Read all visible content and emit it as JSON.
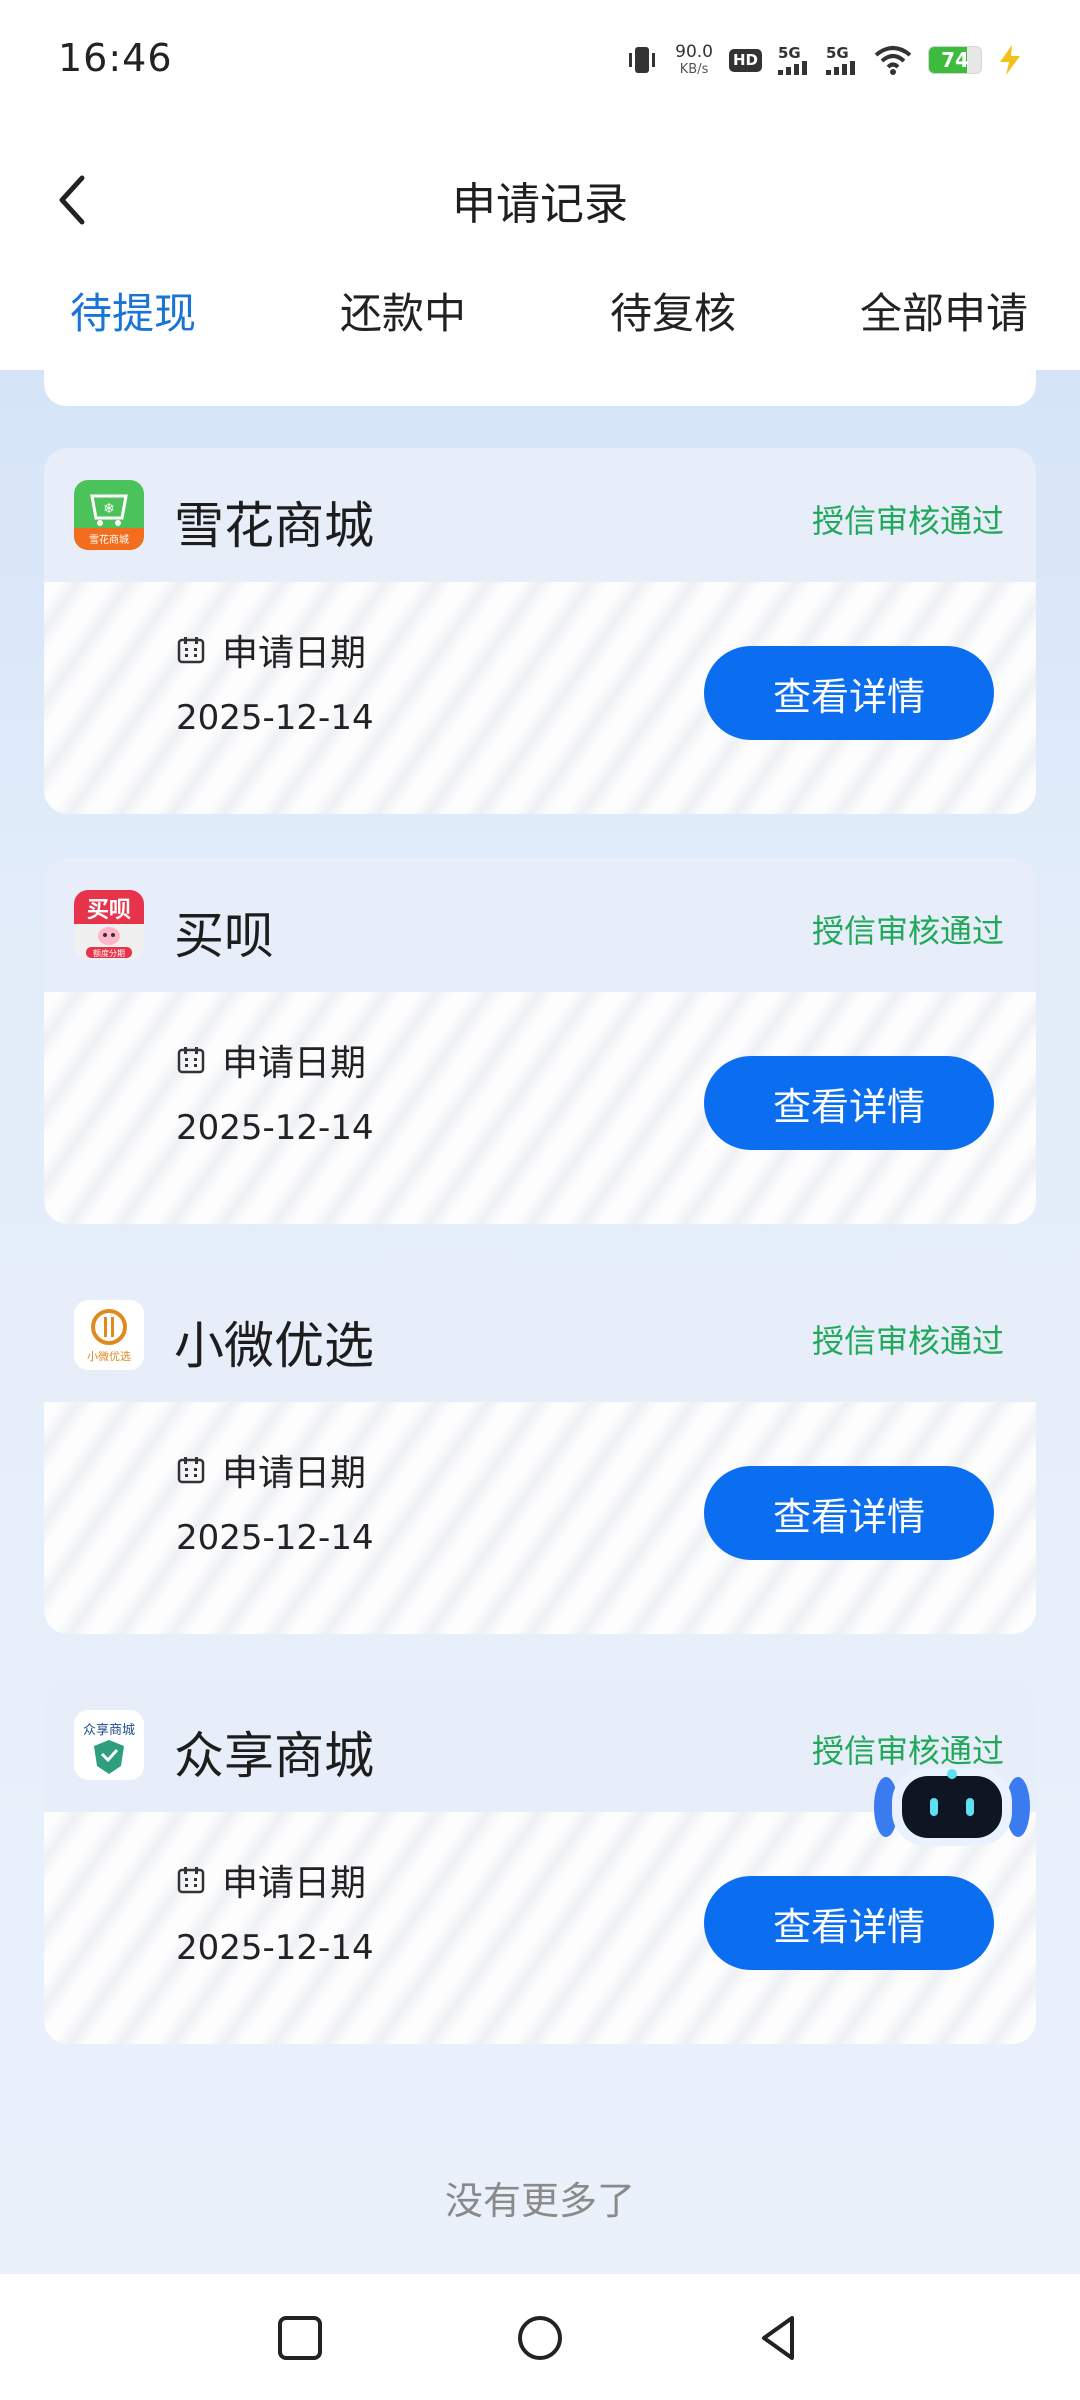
{
  "status_bar": {
    "time": "16:46",
    "net_speed_value": "90.0",
    "net_speed_unit": "KB/s",
    "hd_label": "HD",
    "sim1_label": "5G",
    "sim2_label": "5G",
    "battery_level": "74",
    "battery_color": "#3dbb3d"
  },
  "header": {
    "title": "申请记录",
    "tabs": [
      {
        "label": "待提现",
        "active": true
      },
      {
        "label": "还款中",
        "active": false
      },
      {
        "label": "待复核",
        "active": false
      },
      {
        "label": "全部申请",
        "active": false
      }
    ]
  },
  "colors": {
    "accent": "#1a73d9",
    "button": "#0b6ef0",
    "status_green": "#22a85a"
  },
  "records": [
    {
      "name": "雪花商城",
      "logo_icon": "xuehua-shop-logo-icon",
      "status": "授信审核通过",
      "date_label": "申请日期",
      "date": "2025-12-14",
      "button_label": "查看详情"
    },
    {
      "name": "买呗",
      "logo_icon": "maibei-logo-icon",
      "status": "授信审核通过",
      "date_label": "申请日期",
      "date": "2025-12-14",
      "button_label": "查看详情"
    },
    {
      "name": "小微优选",
      "logo_icon": "xiaowei-youxuan-logo-icon",
      "status": "授信审核通过",
      "date_label": "申请日期",
      "date": "2025-12-14",
      "button_label": "查看详情"
    },
    {
      "name": "众享商城",
      "logo_icon": "zhongxiang-shop-logo-icon",
      "status": "授信审核通过",
      "date_label": "申请日期",
      "date": "2025-12-14",
      "button_label": "查看详情"
    }
  ],
  "logo_texts": {
    "xuehua": "雪花商城",
    "maibei_top": "买呗",
    "maibei_bottom": "额度分期",
    "xiaowei": "小微优选",
    "zhongxiang": "众享商城"
  },
  "footer_text": "没有更多了"
}
